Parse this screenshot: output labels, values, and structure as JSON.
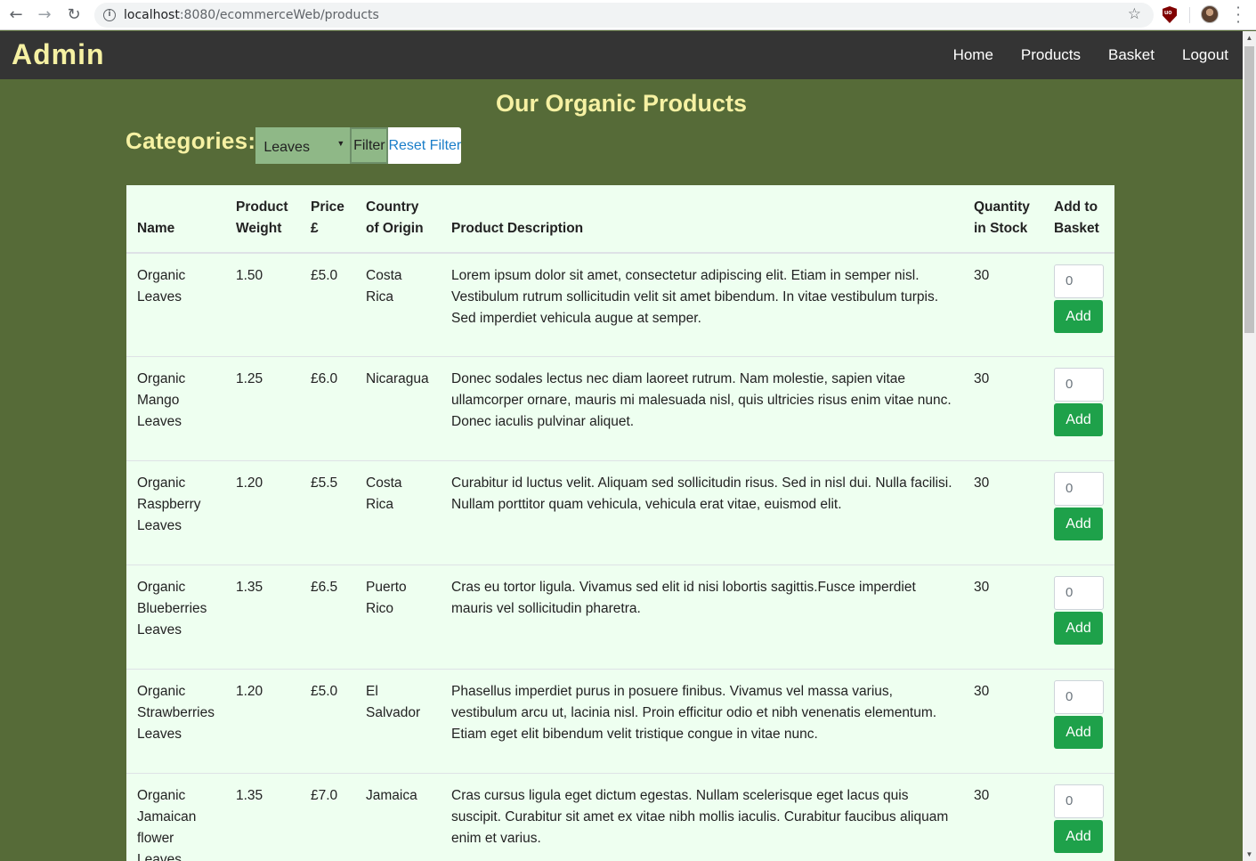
{
  "browser": {
    "url_host": "localhost",
    "url_path": ":8080/ecommerceWeb/products"
  },
  "navbar": {
    "brand": "Admin",
    "links": [
      "Home",
      "Products",
      "Basket",
      "Logout"
    ]
  },
  "page": {
    "title": "Our Organic Products"
  },
  "filter": {
    "label": "Categories:",
    "selected": "Leaves",
    "filter_button": "Filter",
    "reset_button": "Reset Filter"
  },
  "table": {
    "headers": [
      "Name",
      "Product Weight",
      "Price £",
      "Country of Origin",
      "Product Description",
      "Quantity in Stock",
      "Add to Basket"
    ],
    "rows": [
      {
        "name": "Organic Leaves",
        "weight": "1.50",
        "price": "£5.0",
        "country": "Costa Rica",
        "description": "Lorem ipsum dolor sit amet, consectetur adipiscing elit. Etiam in semper nisl. Vestibulum rutrum sollicitudin velit sit amet bibendum. In vitae vestibulum turpis. Sed imperdiet vehicula augue at semper.",
        "stock": "30",
        "qty": "0",
        "add": "Add"
      },
      {
        "name": "Organic Mango Leaves",
        "weight": "1.25",
        "price": "£6.0",
        "country": "Nicaragua",
        "description": "Donec sodales lectus nec diam laoreet rutrum. Nam molestie, sapien vitae ullamcorper ornare, mauris mi malesuada nisl, quis ultricies risus enim vitae nunc. Donec iaculis pulvinar aliquet.",
        "stock": "30",
        "qty": "0",
        "add": "Add"
      },
      {
        "name": "Organic Raspberry Leaves",
        "weight": "1.20",
        "price": "£5.5",
        "country": "Costa Rica",
        "description": "Curabitur id luctus velit. Aliquam sed sollicitudin risus. Sed in nisl dui. Nulla facilisi. Nullam porttitor quam vehicula, vehicula erat vitae, euismod elit.",
        "stock": "30",
        "qty": "0",
        "add": "Add"
      },
      {
        "name": "Organic Blueberries Leaves",
        "weight": "1.35",
        "price": "£6.5",
        "country": "Puerto Rico",
        "description": "Cras eu tortor ligula. Vivamus sed elit id nisi lobortis sagittis.Fusce imperdiet mauris vel sollicitudin pharetra.",
        "stock": "30",
        "qty": "0",
        "add": "Add"
      },
      {
        "name": "Organic Strawberries Leaves",
        "weight": "1.20",
        "price": "£5.0",
        "country": "El Salvador",
        "description": "Phasellus imperdiet purus in posuere finibus. Vivamus vel massa varius, vestibulum arcu ut, lacinia nisl. Proin efficitur odio et nibh venenatis elementum. Etiam eget elit bibendum velit tristique congue in vitae nunc.",
        "stock": "30",
        "qty": "0",
        "add": "Add"
      },
      {
        "name": "Organic Jamaican flower Leaves",
        "weight": "1.35",
        "price": "£7.0",
        "country": "Jamaica",
        "description": "Cras cursus ligula eget dictum egestas. Nullam scelerisque eget lacus quis suscipit. Curabitur sit amet ex vitae nibh mollis iaculis. Curabitur faucibus aliquam enim et varius.",
        "stock": "30",
        "qty": "0",
        "add": "Add"
      }
    ]
  },
  "icons": {
    "back": "arrow-left-icon",
    "forward": "arrow-right-icon",
    "reload": "reload-icon",
    "info": "info-icon",
    "star": "star-icon",
    "ublock": "ublock-icon",
    "avatar": "avatar",
    "menu": "kebab-menu-icon"
  },
  "colors": {
    "page_bg": "#566b38",
    "navbar_bg": "#343434",
    "brand_text": "#f6f1a3",
    "table_bg": "#eefff0",
    "add_button": "#1ea14a",
    "select_bg": "#8fb887",
    "link": "#1a7ec9"
  }
}
